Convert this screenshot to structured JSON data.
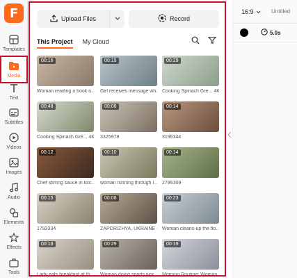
{
  "app": {
    "logo_letter": "F",
    "brand_color": "#ff6a1a",
    "highlight_color": "#c8102e"
  },
  "sidebar": {
    "items": [
      {
        "label": "Templates",
        "icon": "templates-icon"
      },
      {
        "label": "Media",
        "icon": "folder-icon",
        "active": true
      },
      {
        "label": "Text",
        "icon": "text-icon"
      },
      {
        "label": "Subtitles",
        "icon": "subtitles-icon"
      },
      {
        "label": "Videos",
        "icon": "videos-icon"
      },
      {
        "label": "Images",
        "icon": "images-icon"
      },
      {
        "label": "Audio",
        "icon": "audio-icon"
      },
      {
        "label": "Elements",
        "icon": "elements-icon"
      },
      {
        "label": "Effects",
        "icon": "effects-icon"
      },
      {
        "label": "Tools",
        "icon": "tools-icon"
      }
    ]
  },
  "media": {
    "upload_label": "Upload Files",
    "record_label": "Record",
    "tabs": [
      {
        "label": "This Project",
        "active": true
      },
      {
        "label": "My Cloud",
        "active": false
      }
    ],
    "items": [
      {
        "duration": "00:16",
        "caption": "Woman reading a book n...",
        "colors": [
          "#c9b8a6",
          "#8a7868"
        ]
      },
      {
        "duration": "00:19",
        "caption": "Girl receives message wh...",
        "colors": [
          "#b7c4c9",
          "#6e7f86"
        ]
      },
      {
        "duration": "00:29",
        "caption": "Cooking Spinach Gre... 4K",
        "colors": [
          "#cfd8cf",
          "#8d9e8a"
        ]
      },
      {
        "duration": "00:48",
        "caption": "Cooking Spinach Gre... 4K",
        "colors": [
          "#d6d9cf",
          "#7f8a6c"
        ]
      },
      {
        "duration": "00:08",
        "caption": "3325978",
        "colors": [
          "#c9c3b8",
          "#7d6f60"
        ]
      },
      {
        "duration": "00:14",
        "caption": "3196344",
        "colors": [
          "#b9977f",
          "#6b4e3d"
        ]
      },
      {
        "duration": "00:12",
        "caption": "Chef stirring sauce in kitc...",
        "colors": [
          "#8a5a3b",
          "#3a2a22"
        ]
      },
      {
        "duration": "00:10",
        "caption": "woman running through l...",
        "colors": [
          "#c8c6b2",
          "#7c7a5e"
        ]
      },
      {
        "duration": "00:14",
        "caption": "2795309",
        "colors": [
          "#a8b58c",
          "#5e6e44"
        ]
      },
      {
        "duration": "00:15",
        "caption": "1793334",
        "colors": [
          "#d9d2c4",
          "#8c8270"
        ]
      },
      {
        "duration": "00:08",
        "caption": "ZAPORIZHYA, UKRAINE - ...",
        "colors": [
          "#b6aa98",
          "#5d5246"
        ]
      },
      {
        "duration": "00:23",
        "caption": "Woman cleans-up the flo...",
        "colors": [
          "#c9cfd4",
          "#7d8a93"
        ]
      },
      {
        "duration": "00:18",
        "caption": "Lady eats breakfast at th...",
        "colors": [
          "#d9d4cc",
          "#9a8f80"
        ]
      },
      {
        "duration": "00:29",
        "caption": "Woman doing sports wor...",
        "colors": [
          "#b9b3ab",
          "#6b625a"
        ]
      },
      {
        "duration": "00:19",
        "caption": "Morning Routine: Woman ...",
        "colors": [
          "#d4d7dc",
          "#8b8f98"
        ]
      }
    ]
  },
  "right_panel": {
    "ratio": "16:9",
    "title": "Untitled",
    "color_value": "#000000",
    "duration": "5.0s"
  }
}
